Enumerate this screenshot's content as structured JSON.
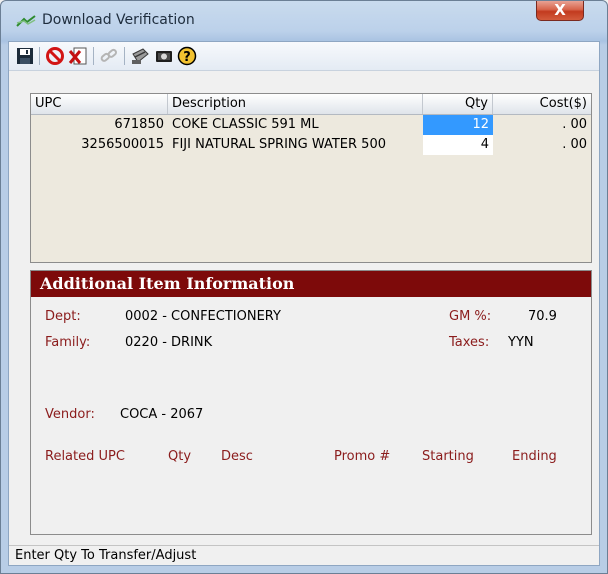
{
  "window": {
    "title": "Download Verification",
    "close_label": "X"
  },
  "toolbar": {
    "buttons": [
      {
        "name": "save",
        "icon": "floppy-disk-icon"
      },
      {
        "name": "cancel",
        "icon": "no-entry-icon"
      },
      {
        "name": "delete",
        "icon": "delete-document-icon"
      },
      {
        "name": "link",
        "icon": "link-icon"
      },
      {
        "name": "scan",
        "icon": "scanner-icon"
      },
      {
        "name": "camera",
        "icon": "camera-icon"
      },
      {
        "name": "help",
        "icon": "help-icon"
      }
    ]
  },
  "grid": {
    "columns": [
      "UPC",
      "Description",
      "Qty",
      "Cost($)"
    ],
    "rows": [
      {
        "upc": "671850",
        "description": "COKE CLASSIC 591 ML",
        "qty": "12",
        "cost": ". 00"
      },
      {
        "upc": "3256500015",
        "description": "FIJI NATURAL SPRING WATER 500",
        "qty": "4",
        "cost": ". 00"
      }
    ]
  },
  "info": {
    "header": "Additional Item Information",
    "dept_label": "Dept:",
    "dept_value": "0002 - CONFECTIONERY",
    "gm_label": "GM %:",
    "gm_value": "70.9",
    "family_label": "Family:",
    "family_value": "0220 - DRINK",
    "taxes_label": "Taxes:",
    "taxes_value": "YYN",
    "vendor_label": "Vendor:",
    "vendor_value": "COCA - 2067",
    "related_columns": [
      "Related UPC",
      "Qty",
      "Desc",
      "Promo #",
      "Starting",
      "Ending"
    ]
  },
  "status": {
    "text": "Enter Qty To Transfer/Adjust"
  },
  "colors": {
    "section_header": "#7d0a0a",
    "label": "#8b1c1c",
    "selection": "#3399ff"
  }
}
